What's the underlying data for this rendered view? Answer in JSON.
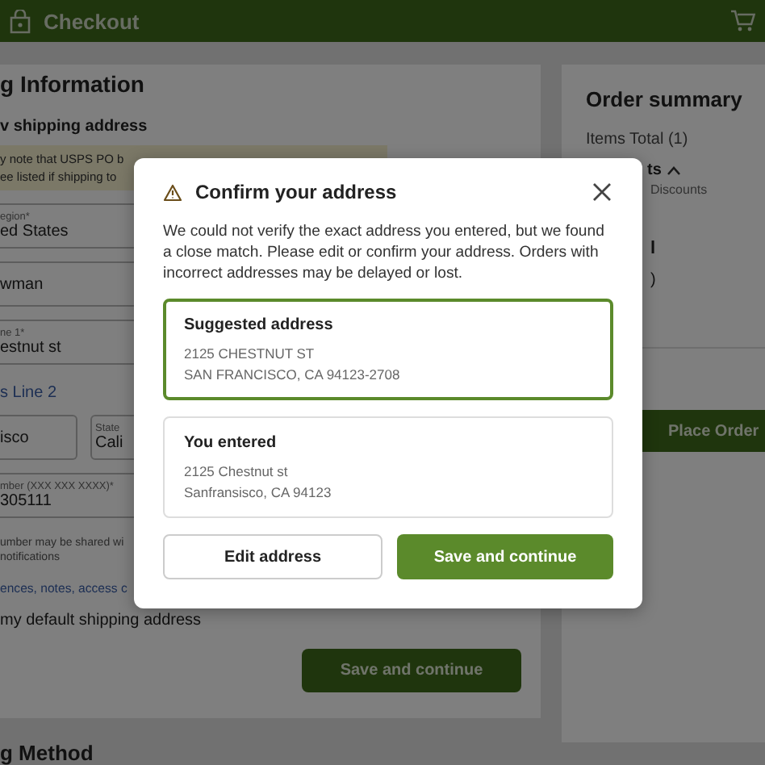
{
  "header": {
    "title": "Checkout"
  },
  "form": {
    "heading": "g Information",
    "subheading": "v shipping address",
    "notice_lines": [
      "y note that USPS PO b",
      "ee listed if shipping to"
    ],
    "field_rows": [
      [
        {
          "label": "egion*",
          "value": "ed States"
        }
      ],
      [
        {
          "value": "wman"
        }
      ],
      [
        {
          "label": "ne 1*",
          "value": "estnut st"
        }
      ],
      [
        {
          "kind": "link",
          "value": "s Line 2"
        }
      ],
      [
        {
          "value": "isco"
        },
        {
          "label": "State",
          "value": "Cali"
        }
      ],
      [
        {
          "label": "mber (XXX XXX XXXX)*",
          "value": "305111"
        }
      ]
    ],
    "hint_lines": [
      "umber may be shared wi",
      "notifications"
    ],
    "notes_link": "ences, notes, access c",
    "default_label": "my default shipping address",
    "save_button": "Save and continue",
    "next_heading": "g Method"
  },
  "summary": {
    "title": "Order summary",
    "items_total": "Items Total (1)",
    "discounts_toggle": "ts",
    "discounts_expanded": true,
    "discounts": "Discounts",
    "total_label": "l",
    "total_value": ")",
    "place_order": "Place Order"
  },
  "modal": {
    "title": "Confirm your address",
    "message": "We could not verify the exact address you entered, but we found a close match. Please edit or confirm your address. Orders with incorrect addresses may be delayed or lost.",
    "options": [
      {
        "title": "Suggested address",
        "lines": [
          "2125 CHESTNUT ST",
          "SAN FRANCISCO, CA 94123-2708"
        ],
        "selected": true
      },
      {
        "title": "You entered",
        "lines": [
          "2125 Chestnut st",
          "Sanfransisco, CA 94123"
        ],
        "selected": false
      }
    ],
    "buttons": [
      {
        "label": "Edit address",
        "kind": "secondary"
      },
      {
        "label": "Save and continue",
        "kind": "primary"
      }
    ]
  }
}
